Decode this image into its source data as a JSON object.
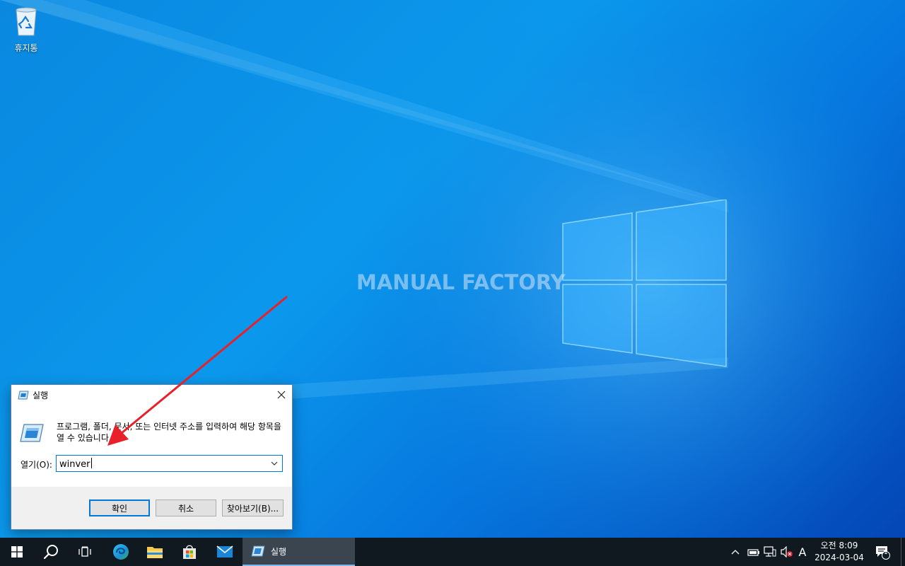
{
  "desktop": {
    "watermark": "MANUAL FACTORY",
    "icons": [
      {
        "label": "휴지통",
        "icon": "recycle-bin-icon"
      }
    ]
  },
  "run_dialog": {
    "title": "실행",
    "description": "프로그램, 폴더, 문서, 또는 인터넷 주소를 입력하여 해당 항목을 열 수 있습니다.",
    "open_label": "열기(O):",
    "input_value": "winver",
    "buttons": {
      "ok": "확인",
      "cancel": "취소",
      "browse": "찾아보기(B)..."
    }
  },
  "taskbar": {
    "pinned": [
      "start-icon",
      "search-icon",
      "task-view-icon",
      "edge-icon",
      "file-explorer-icon",
      "store-icon",
      "mail-icon"
    ],
    "running_app": "실행",
    "tray": {
      "ime": "A"
    },
    "clock": {
      "time": "오전 8:09",
      "date": "2024-03-04"
    },
    "notification_count": "1"
  },
  "colors": {
    "accent": "#0078d7",
    "arrow": "#e8202a",
    "taskbar": "#101820"
  }
}
